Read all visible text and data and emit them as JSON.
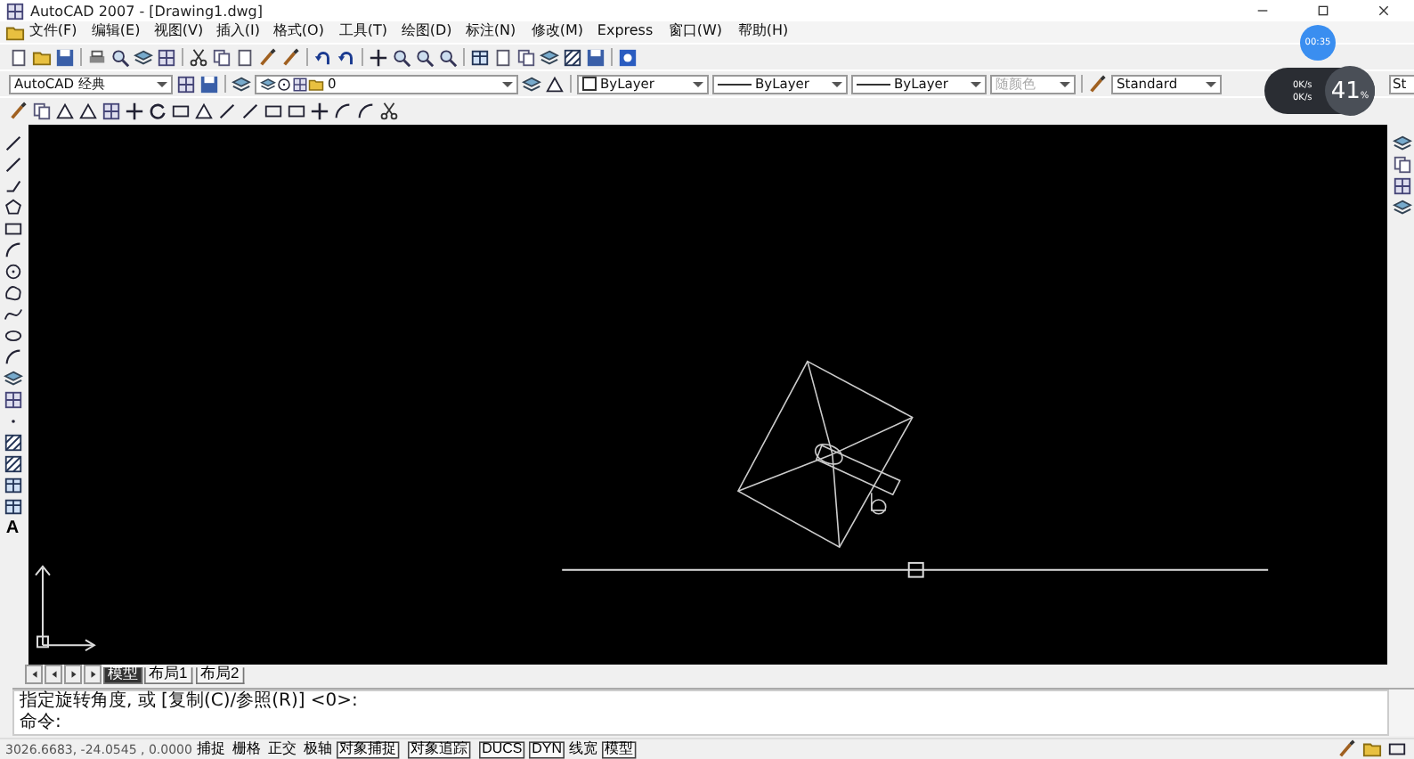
{
  "window": {
    "title": "AutoCAD 2007 - [Drawing1.dwg]"
  },
  "menu_bar": {
    "items": [
      "文件(F)",
      "编辑(E)",
      "视图(V)",
      "插入(I)",
      "格式(O)",
      "工具(T)",
      "绘图(D)",
      "标注(N)",
      "修改(M)",
      "Express",
      "窗口(W)",
      "帮助(H)"
    ]
  },
  "properties_toolbar": {
    "workspace": "AutoCAD 经典",
    "layer": "0",
    "fields": [
      {
        "kind": "color",
        "value": "ByLayer",
        "disabled": false
      },
      {
        "kind": "linetype",
        "value": "ByLayer",
        "disabled": false
      },
      {
        "kind": "linetype",
        "value": "ByLayer",
        "disabled": false
      },
      {
        "kind": "plain",
        "value": "随颜色",
        "disabled": true
      }
    ],
    "text_style": "Standard",
    "dim_style": "St"
  },
  "draw_toolbar": {
    "text_tool": "A"
  },
  "layout_tabs": [
    {
      "label": "模型",
      "selected": true
    },
    {
      "label": "布局1",
      "selected": false
    },
    {
      "label": "布局2",
      "selected": false
    }
  ],
  "command_window": {
    "lines": [
      "指定旋转角度, 或 [复制(C)/参照(R)] <0>:",
      "命令:"
    ]
  },
  "status_bar": {
    "coordinates": "3026.6683, -24.0545 , 0.0000",
    "toggles": [
      {
        "label": "捕捉",
        "on": false
      },
      {
        "label": "栅格",
        "on": false
      },
      {
        "label": "正交",
        "on": false
      },
      {
        "label": "极轴",
        "on": false
      },
      {
        "label": "对象捕捉",
        "on": true
      },
      {
        "label": "对象追踪",
        "on": true
      },
      {
        "label": "DUCS",
        "on": true
      },
      {
        "label": "DYN",
        "on": true
      },
      {
        "label": "线宽",
        "on": false
      },
      {
        "label": "模型",
        "on": true
      }
    ]
  },
  "overlay": {
    "timer": "00:35",
    "speed_percent": "41",
    "percent_sign": "%",
    "upload": "0K/s",
    "download": "0K/s"
  }
}
